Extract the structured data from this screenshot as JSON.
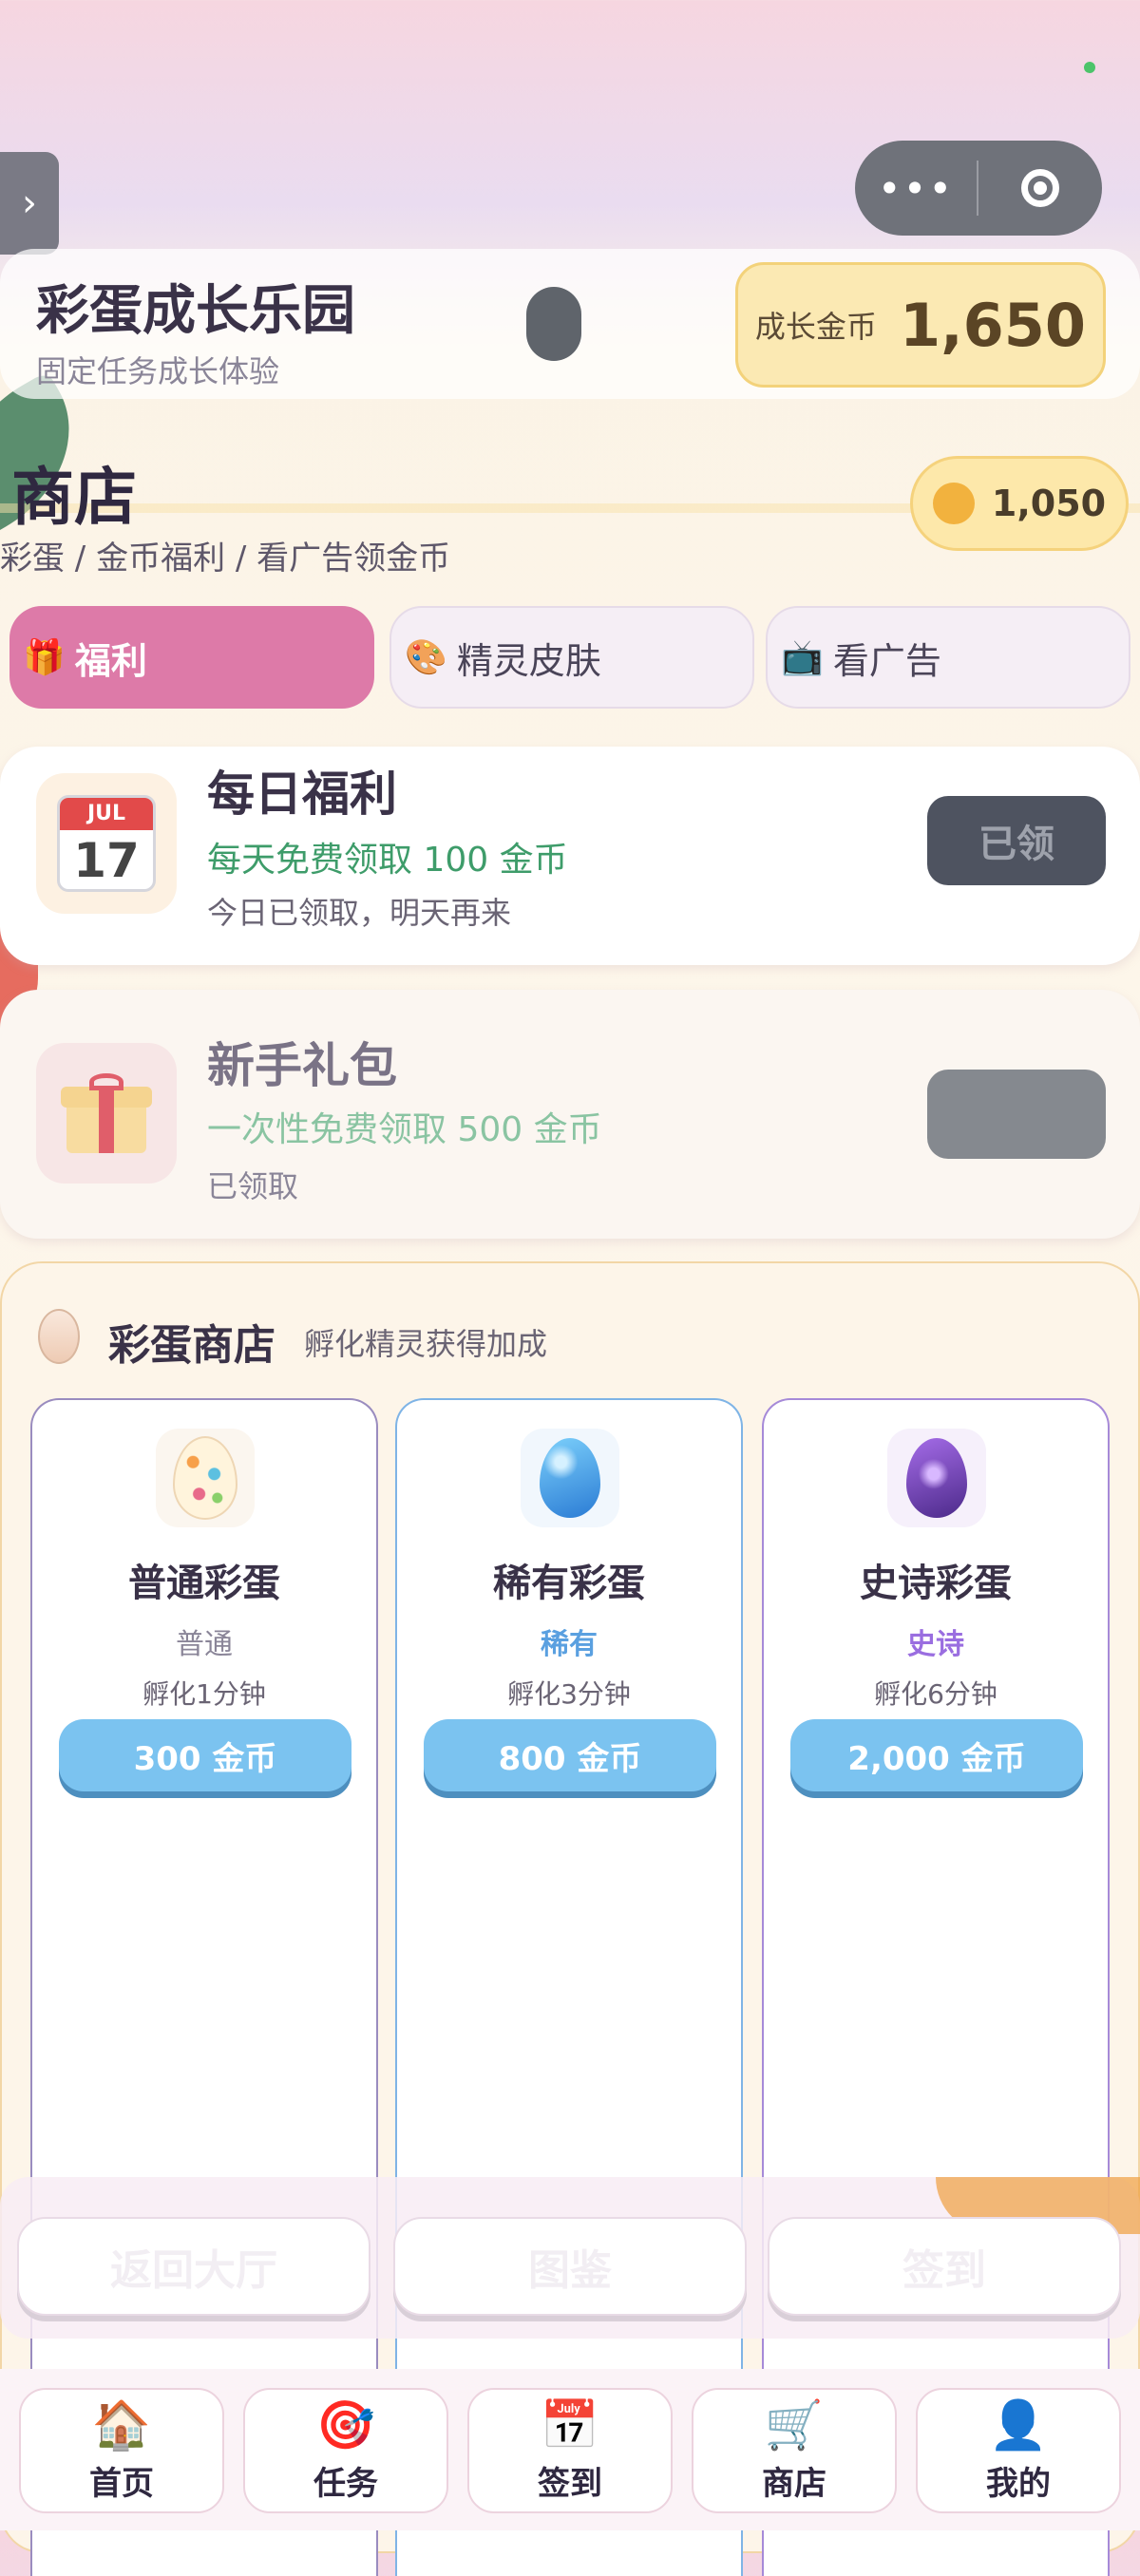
{
  "header": {
    "title": "彩蛋成长乐园",
    "subtitle": "固定任务成长体验",
    "coin_label": "成长金币",
    "coin_value": "1,650"
  },
  "shop": {
    "title": "商店",
    "breadcrumb": "彩蛋 / 金币福利 / 看广告领金币",
    "coins": "1,050",
    "tabs": [
      {
        "label": "福利",
        "icon": "gift-icon",
        "active": true
      },
      {
        "label": "精灵皮肤",
        "icon": "palette-icon",
        "active": false
      },
      {
        "label": "看广告",
        "icon": "tv-icon",
        "active": false
      }
    ]
  },
  "welfare": [
    {
      "title": "每日福利",
      "desc": "每天免费领取 100 金币",
      "status": "今日已领取，明天再来",
      "button": "已领",
      "icon": "calendar-icon",
      "cal_month": "JUL",
      "cal_day": "17"
    },
    {
      "title": "新手礼包",
      "desc": "一次性免费领取 500 金币",
      "status": "已领取",
      "button": "",
      "icon": "gift-box-icon"
    }
  ],
  "egg_shop": {
    "title": "彩蛋商店",
    "subtitle": "孵化精灵获得加成",
    "eggs": [
      {
        "name": "普通彩蛋",
        "rarity": "普通",
        "hatch": "孵化1分钟",
        "price": "300 金币",
        "rarity_color": "#8a8598"
      },
      {
        "name": "稀有彩蛋",
        "rarity": "稀有",
        "hatch": "孵化3分钟",
        "price": "800 金币",
        "rarity_color": "#5aa0e0"
      },
      {
        "name": "史诗彩蛋",
        "rarity": "史诗",
        "hatch": "孵化6分钟",
        "price": "2,000 金币",
        "rarity_color": "#9a6ee0"
      }
    ]
  },
  "actions": [
    "返回大厅",
    "图鉴",
    "签到"
  ],
  "nav": [
    {
      "label": "首页",
      "icon": "home-icon"
    },
    {
      "label": "任务",
      "icon": "target-icon"
    },
    {
      "label": "签到",
      "icon": "calendar-icon"
    },
    {
      "label": "商店",
      "icon": "cart-icon"
    },
    {
      "label": "我的",
      "icon": "user-icon"
    }
  ],
  "colors": {
    "accent_pink": "#dd7aa8",
    "coin_yellow": "#fbe9b3",
    "price_blue": "#7bc3f0",
    "green_text": "#3e9c6a"
  }
}
